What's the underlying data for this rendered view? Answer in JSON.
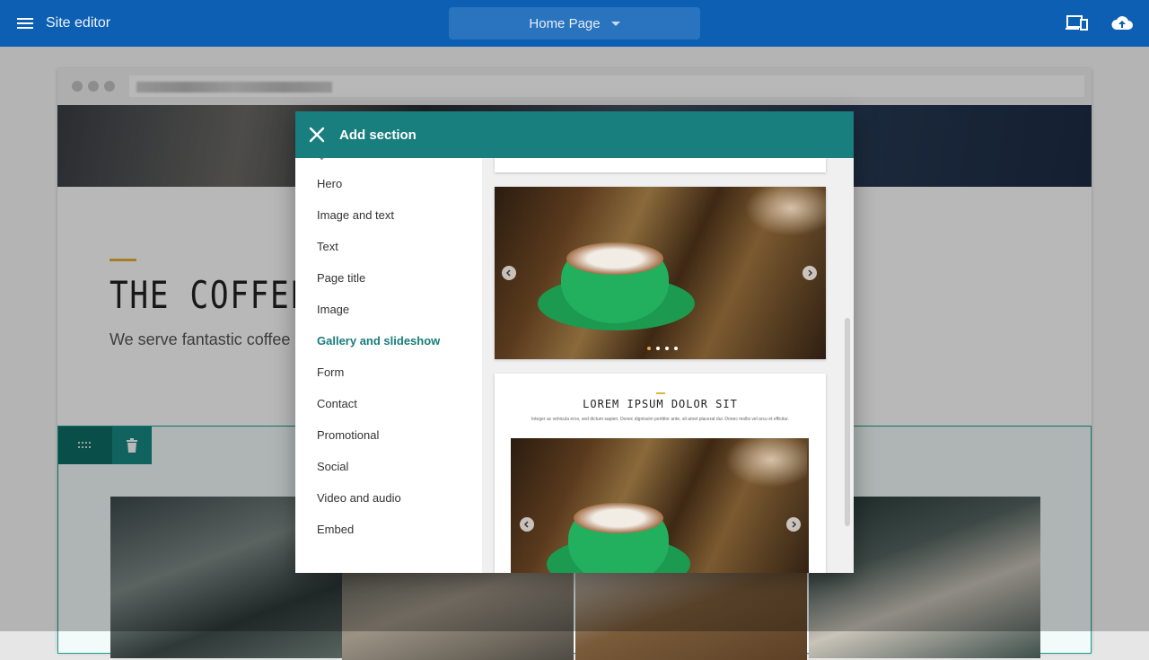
{
  "appbar": {
    "title": "Site editor",
    "page_select": "Home Page"
  },
  "preview_page": {
    "heading": "THE COFFEE",
    "subheading": "We serve fantastic coffee"
  },
  "dialog": {
    "title": "Add section",
    "categories": [
      {
        "label": "Hero"
      },
      {
        "label": "Image and text"
      },
      {
        "label": "Text"
      },
      {
        "label": "Page title"
      },
      {
        "label": "Image"
      },
      {
        "label": "Gallery and slideshow",
        "active": true
      },
      {
        "label": "Form"
      },
      {
        "label": "Contact"
      },
      {
        "label": "Promotional"
      },
      {
        "label": "Social"
      },
      {
        "label": "Video and audio"
      },
      {
        "label": "Embed"
      }
    ],
    "gallery_preview": {
      "title": "LOREM IPSUM DOLOR SIT",
      "body": "Integer ac vehicula eros, sed dictum sapien. Donec dignissim porttitor ante, sit amet placerat dui. Donec mollis vel arcu et efficitur."
    }
  },
  "colors": {
    "appbar": "#0d5fb3",
    "dialog_header": "#197e7e",
    "accent": "#e0b23a",
    "active_category": "#187d7a"
  }
}
